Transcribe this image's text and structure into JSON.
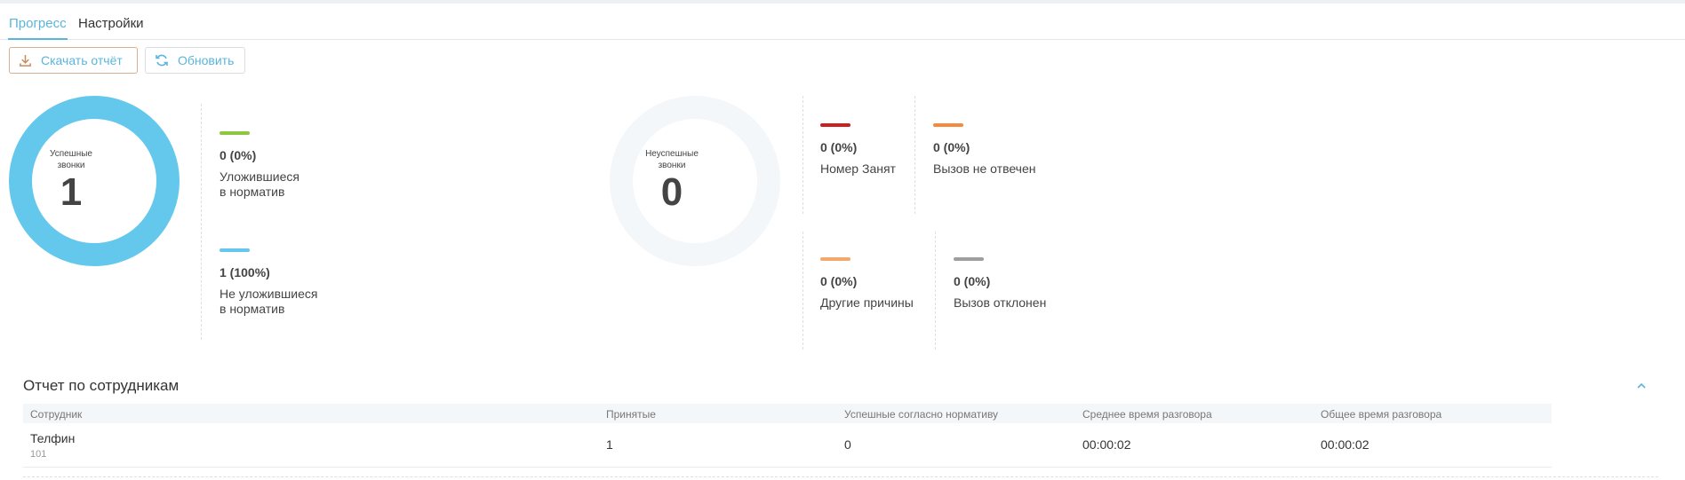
{
  "tabs": [
    {
      "label": "Прогресс",
      "active": true
    },
    {
      "label": "Настройки",
      "active": false
    }
  ],
  "toolbar": {
    "download_label": "Скачать отчёт",
    "refresh_label": "Обновить"
  },
  "successful": {
    "title_line1": "Успешные",
    "title_line2": "звонки",
    "count": "1",
    "color": "#64c8ec",
    "stats": [
      {
        "value": "0 (0%)",
        "label_line1": "Уложившиеся",
        "label_line2": "в норматив",
        "color": "#8dc63f",
        "fraction": 0
      },
      {
        "value": "1 (100%)",
        "label_line1": "Не уложившиеся",
        "label_line2": "в норматив",
        "color": "#64c8ec",
        "fraction": 1
      }
    ]
  },
  "unsuccessful": {
    "title_line1": "Неуспешные",
    "title_line2": "звонки",
    "count": "0",
    "color": "#f3f7fa",
    "stats": [
      {
        "value": "0 (0%)",
        "label": "Номер Занят",
        "color": "#cc1f1f"
      },
      {
        "value": "0 (0%)",
        "label": "Вызов не отвечен",
        "color": "#f5893e"
      },
      {
        "value": "0 (0%)",
        "label": "Другие причины",
        "color": "#f2a96b"
      },
      {
        "value": "0 (0%)",
        "label": "Вызов отклонен",
        "color": "#9e9e9e"
      }
    ]
  },
  "report": {
    "title": "Отчет по сотрудникам",
    "columns": [
      "Сотрудник",
      "Принятые",
      "Успешные согласно нормативу",
      "Среднее время разговора",
      "Общее время разговора"
    ],
    "rows": [
      {
        "name": "Телфин",
        "ext": "101",
        "accepted": "1",
        "successful": "0",
        "avg_time": "00:00:02",
        "total_time": "00:00:02"
      }
    ]
  }
}
